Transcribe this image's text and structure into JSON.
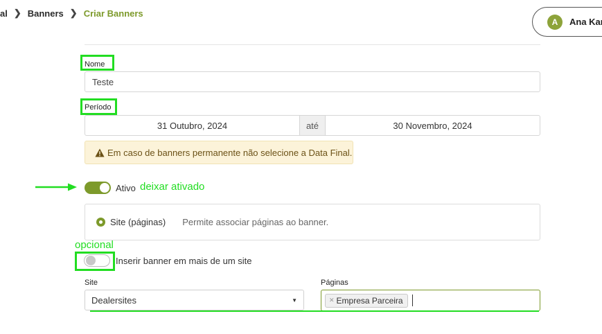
{
  "breadcrumb": {
    "items": [
      "al",
      "Banners",
      "Criar Banners"
    ]
  },
  "user": {
    "initial": "A",
    "name": "Ana Karo"
  },
  "form": {
    "nome": {
      "label": "Nome",
      "value": "Teste"
    },
    "periodo": {
      "label": "Período",
      "start": "31 Outubro, 2024",
      "connector": "até",
      "end": "30 Novembro, 2024"
    },
    "alert_text": "Em caso de banners permanente não selecione a Data Final.",
    "ativo": {
      "label": "Ativo",
      "on": true
    },
    "site_option": {
      "label": "Site (páginas)",
      "description": "Permite associar páginas ao banner.",
      "selected": true
    },
    "multi_site": {
      "label": "Inserir banner em mais de um site",
      "on": false
    },
    "site_select": {
      "label": "Site",
      "value": "Dealersites"
    },
    "paginas": {
      "label": "Páginas",
      "tags": [
        "Empresa Parceira"
      ]
    }
  },
  "annotations": {
    "ativo_note": "deixar ativado",
    "optional_note": "opcional"
  },
  "colors": {
    "accent": "#7d9a2b",
    "annotation": "#22dd22",
    "alert_bg": "#fcf3d9"
  }
}
